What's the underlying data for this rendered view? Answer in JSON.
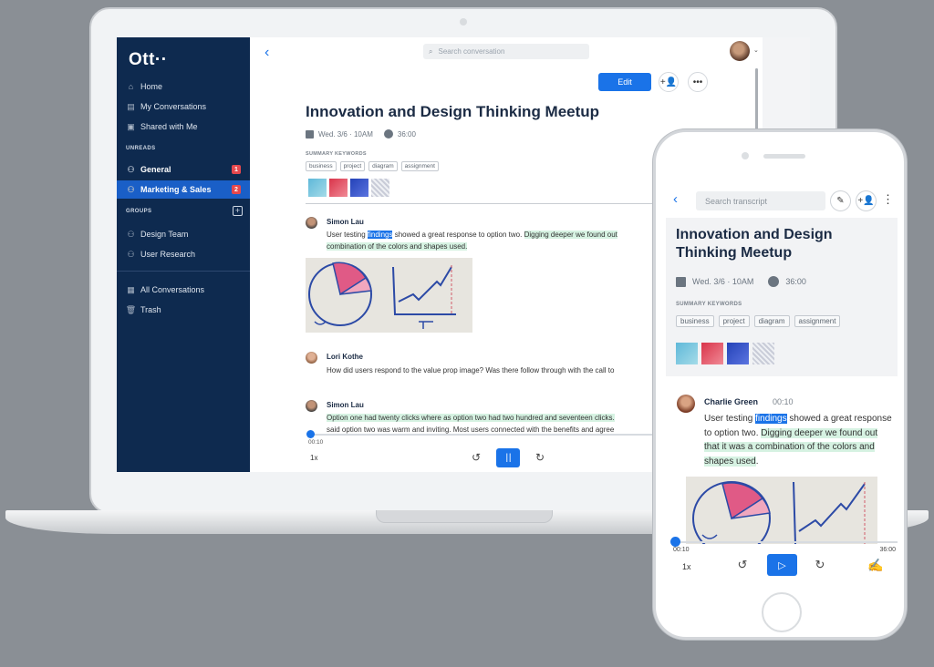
{
  "desktop": {
    "logo": "Ott··",
    "nav": [
      {
        "label": "Home",
        "icon": "home-icon"
      },
      {
        "label": "My Conversations",
        "icon": "conversations-icon"
      },
      {
        "label": "Shared with Me",
        "icon": "shared-icon"
      }
    ],
    "unreads_label": "UNREADS",
    "unreads": [
      {
        "label": "General",
        "badge": "1",
        "icon": "group-icon"
      },
      {
        "label": "Marketing & Sales",
        "badge": "2",
        "icon": "group-icon"
      }
    ],
    "groups_label": "GROUPS",
    "add_group_symbol": "+",
    "groups": [
      {
        "label": "Design Team",
        "icon": "group-icon"
      },
      {
        "label": "User Research",
        "icon": "group-icon"
      }
    ],
    "bottom_nav": [
      {
        "label": "All Conversations",
        "icon": "all-conversations-icon"
      },
      {
        "label": "Trash",
        "icon": "trash-icon"
      }
    ],
    "search_placeholder": "Search conversation",
    "edit_label": "Edit",
    "title": "Innovation and Design Thinking Meetup",
    "date": "Wed. 3/6 · 10AM",
    "duration": "36:00",
    "keywords_label": "SUMMARY KEYWORDS",
    "keywords": [
      "business",
      "project",
      "diagram",
      "assignment"
    ],
    "entries": [
      {
        "speaker": "Simon Lau",
        "line1_pre": "User testing ",
        "line1_hl": "findings",
        "line1_mid": " showed a great response to option two. ",
        "line1_green": "Digging deeper we found out",
        "line2_green": "combination of the colors and shapes used."
      },
      {
        "speaker": "Lori Kothe",
        "line1": "How did users respond to the value prop image? Was there follow through with the call to"
      },
      {
        "speaker": "Simon Lau",
        "line1_green": "Option one had twenty clicks where as option two had two hundred and seventeen clicks.",
        "line2": "said option two was warm and inviting. Most users connected with the benefits and agree"
      }
    ],
    "current_time": "00:10",
    "speed": "1x"
  },
  "mobile": {
    "search_placeholder": "Search transcript",
    "title": "Innovation and Design Thinking Meetup",
    "date": "Wed. 3/6 · 10AM",
    "duration": "36:00",
    "keywords_label": "SUMMARY KEYWORDS",
    "keywords": [
      "business",
      "project",
      "diagram",
      "assignment"
    ],
    "speaker": "Charlie Green",
    "speaker_time": "00:10",
    "text_pre": "User testing ",
    "text_hl": "findings",
    "text_mid": " showed a great response to option two. ",
    "text_green": "Digging deeper we found out that it was a combination of the colors and shapes used",
    "text_end": ".",
    "current_time": "00:10",
    "total_time": "36:00",
    "speed": "1x",
    "progress_fraction": 0.005
  },
  "colors": {
    "sidebar": "#0e2a4f",
    "accent": "#1a73e8",
    "badge": "#e5484d",
    "highlight_green": "#d6f2e2"
  }
}
